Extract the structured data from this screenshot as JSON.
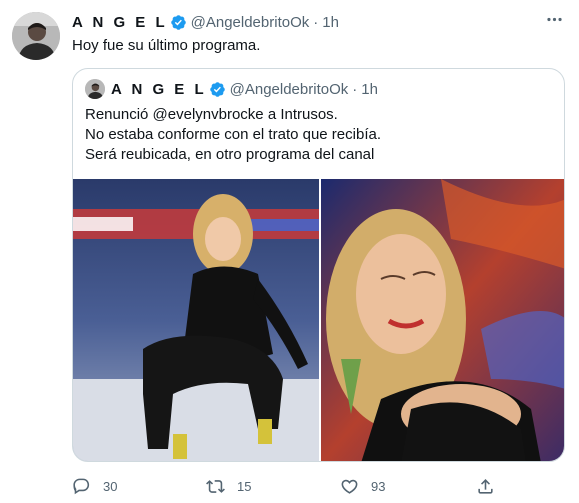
{
  "tweet": {
    "author_name": "A N G E L",
    "handle": "@AngeldebritoOk",
    "separator": "·",
    "time": "1h",
    "text": "Hoy fue su último programa."
  },
  "quoted": {
    "author_name": "A N G E L",
    "handle": "@AngeldebritoOk",
    "separator": "·",
    "time": "1h",
    "lines": [
      "Renunció @evelynvbrocke a Intrusos.",
      "No estaba conforme con el trato que recibía.",
      "Será reubicada, en otro programa del canal"
    ]
  },
  "actions": {
    "reply_count": "30",
    "retweet_count": "15",
    "like_count": "93"
  },
  "icons": {
    "verified": "verified-badge-icon",
    "more": "more-options-icon",
    "reply": "reply-icon",
    "retweet": "retweet-icon",
    "like": "heart-icon",
    "share": "share-icon"
  },
  "colors": {
    "text_primary": "#0f1419",
    "text_secondary": "#536471",
    "verified_blue": "#1d9bf0",
    "border": "#cfd9de"
  }
}
